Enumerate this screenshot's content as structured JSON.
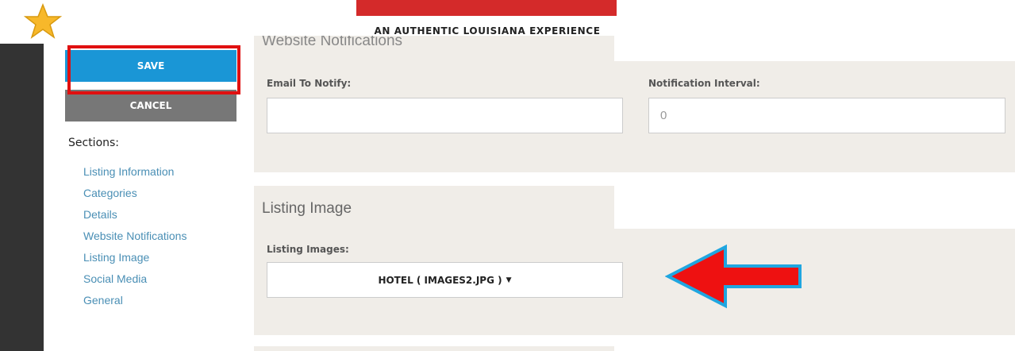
{
  "brand": {
    "tagline": "AN AUTHENTIC LOUISIANA EXPERIENCE"
  },
  "actions": {
    "save_label": "SAVE",
    "cancel_label": "CANCEL"
  },
  "sections": {
    "title": "Sections:",
    "items": [
      "Listing Information",
      "Categories",
      "Details",
      "Website Notifications",
      "Listing Image",
      "Social Media",
      "General"
    ]
  },
  "website_notifications": {
    "title": "Website Notifications",
    "email_label": "Email To Notify:",
    "email_value": "",
    "interval_label": "Notification Interval:",
    "interval_value": "0"
  },
  "listing_image": {
    "title": "Listing Image",
    "images_label": "Listing Images:",
    "selected_image": "HOTEL ( IMAGES2.JPG )"
  },
  "colors": {
    "save_button": "#1a96d6",
    "cancel_button": "#777777",
    "annotation_red": "#e01010",
    "annotation_arrow_outline": "#1fa6e0",
    "brand_red": "#d42a2a",
    "section_link": "#4a8fb5",
    "panel_bg": "#f0ede8"
  },
  "icons": {
    "logo": "star-icon",
    "dropdown": "caret-down-icon",
    "annotation": "left-arrow-icon"
  }
}
